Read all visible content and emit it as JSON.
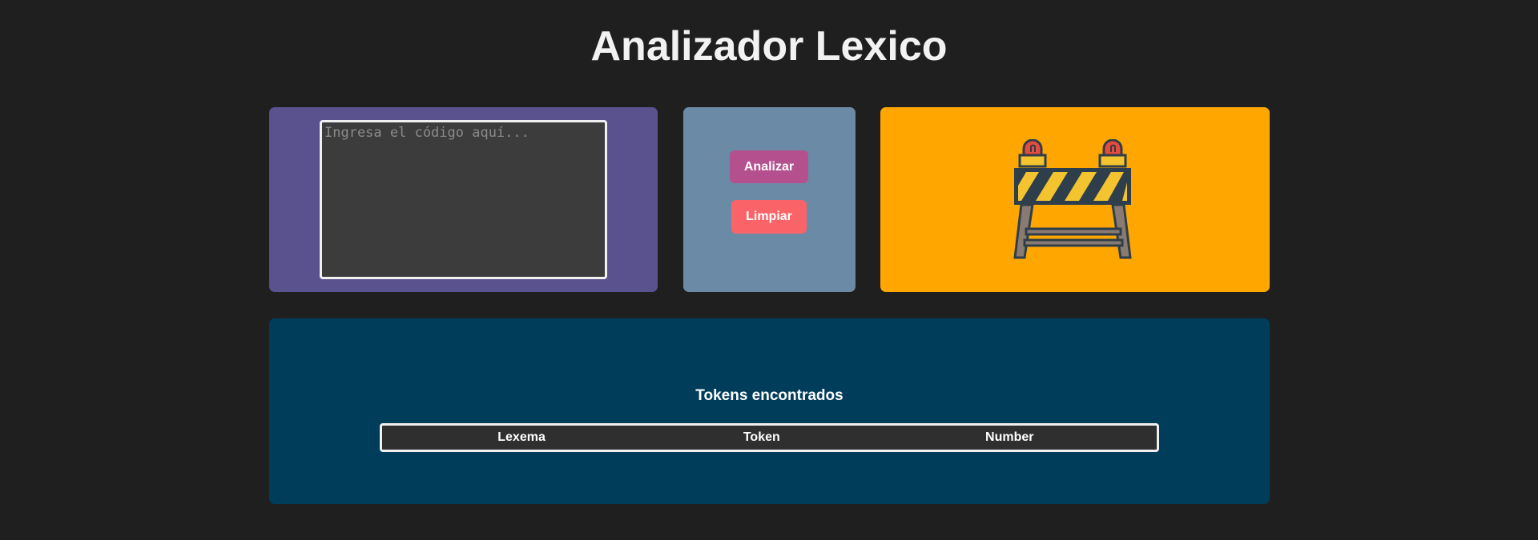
{
  "header": {
    "title": "Analizador Lexico"
  },
  "editor": {
    "placeholder": "Ingresa el código aquí...",
    "value": ""
  },
  "actions": {
    "analyze_label": "Analizar",
    "clear_label": "Limpiar"
  },
  "illustration": {
    "icon": "construction-barrier-icon"
  },
  "results": {
    "heading": "Tokens encontrados",
    "columns": [
      "Lexema",
      "Token",
      "Number"
    ],
    "rows": []
  },
  "colors": {
    "background": "#1f1f1f",
    "editor_panel": "#5a528e",
    "actions_panel": "#6b8aa5",
    "image_panel": "#ffa600",
    "results_panel": "#003d5b",
    "analyze_button": "#b5508f",
    "clear_button": "#fa6468"
  }
}
